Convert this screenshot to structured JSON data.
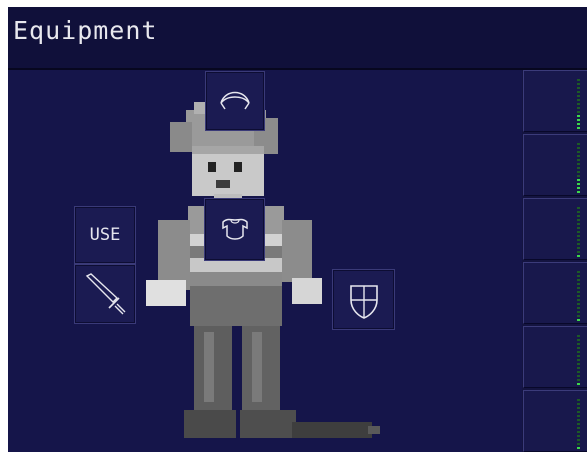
{
  "window": {
    "title": "Equipment"
  },
  "slots": {
    "head": {
      "icon": "helmet-icon"
    },
    "body": {
      "icon": "body-armor-icon"
    },
    "use": {
      "label": "USE"
    },
    "weapon": {
      "icon": "sword-icon"
    },
    "shield": {
      "icon": "shield-icon"
    }
  },
  "side_slots": [
    {
      "icon": "level-meter-icon",
      "level": 0.3
    },
    {
      "icon": "level-meter-icon",
      "level": 0.3
    },
    {
      "icon": "level-meter-icon",
      "level": 0.1
    },
    {
      "icon": "level-meter-icon",
      "level": 0.1
    },
    {
      "icon": "level-meter-icon",
      "level": 0.1
    },
    {
      "icon": "level-meter-icon",
      "level": 0.1
    }
  ],
  "colors": {
    "background": "#141440",
    "slot": "#1b1b52",
    "meter_on": "#3ed84a",
    "meter_off": "#1d5a26"
  }
}
